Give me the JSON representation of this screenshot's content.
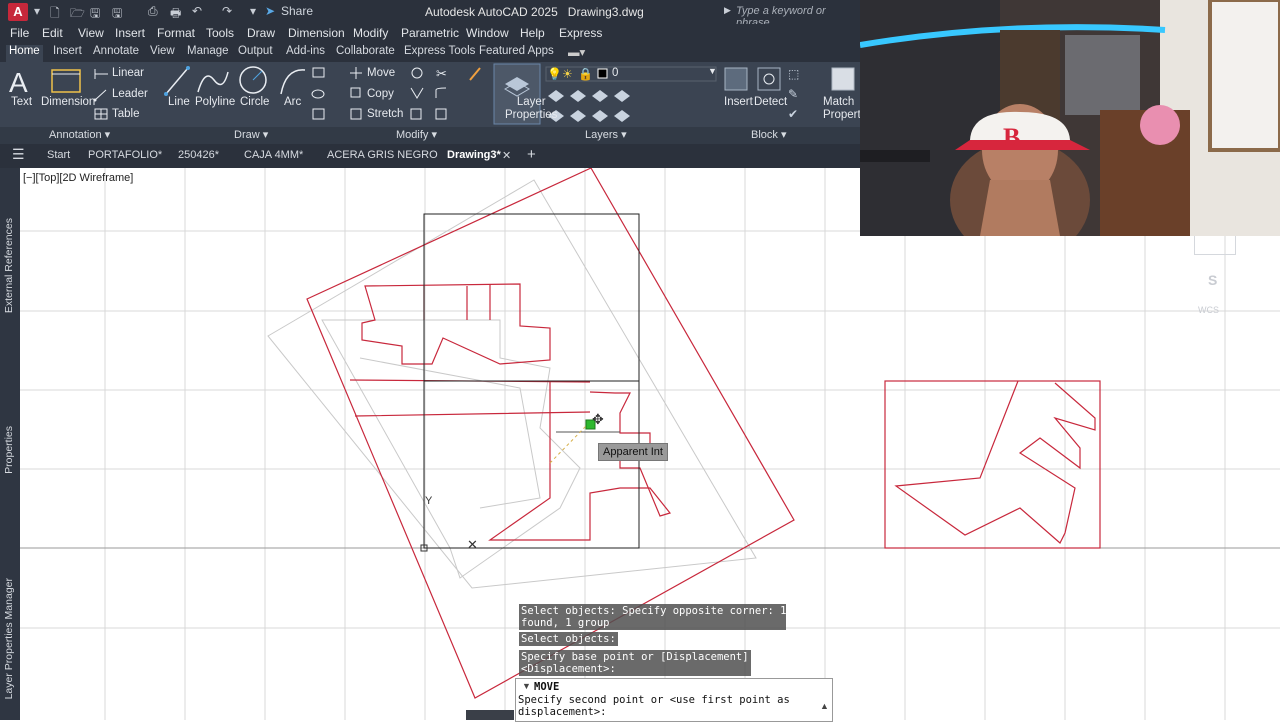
{
  "titlebar": {
    "app_title": "Autodesk AutoCAD 2025",
    "file_name": "Drawing3.dwg",
    "share_label": "Share",
    "search_placeholder": "Type a keyword or phrase"
  },
  "menubar": [
    "File",
    "Edit",
    "View",
    "Insert",
    "Format",
    "Tools",
    "Draw",
    "Dimension",
    "Modify",
    "Parametric",
    "Window",
    "Help",
    "Express"
  ],
  "ribbon_tabs": [
    "Home",
    "Insert",
    "Annotate",
    "View",
    "Manage",
    "Output",
    "Add-ins",
    "Collaborate",
    "Express Tools",
    "Featured Apps"
  ],
  "ribbon": {
    "text": "Text",
    "dimension": "Dimension",
    "linear": "Linear",
    "leader": "Leader",
    "table": "Table",
    "line": "Line",
    "polyline": "Polyline",
    "circle": "Circle",
    "arc": "Arc",
    "move": "Move",
    "copy": "Copy",
    "stretch": "Stretch",
    "layer_properties_1": "Layer",
    "layer_properties_2": "Properties",
    "layer_current": "0",
    "insert": "Insert",
    "detect": "Detect",
    "match_1": "Match",
    "match_2": "Properties"
  },
  "panels": {
    "annotation": "Annotation",
    "draw": "Draw",
    "modify": "Modify",
    "layers": "Layers",
    "block": "Block"
  },
  "file_tabs": [
    "Start",
    "PORTAFOLIO*",
    "250426*",
    "CAJA 4MM*",
    "ACERA GRIS NEGRO",
    "Drawing3*"
  ],
  "left_palettes": [
    "External References",
    "Properties",
    "Layer Properties Manager"
  ],
  "viewport_label": "[−][Top][2D Wireframe]",
  "snap_tooltip": "Apparent Int",
  "command_history": [
    "Select objects: Specify opposite corner: 102\nfound, 1 group",
    "Select objects:",
    "Specify base point or [Displacement]\n<Displacement>:"
  ],
  "command": {
    "name": "MOVE",
    "prompt": "Specify second point or <use first point as\ndisplacement>:"
  },
  "viewcube": {
    "south": "S",
    "wcs": "WCS"
  },
  "colors": {
    "geometry_red": "#c8283c",
    "ribbon_bg": "#3b4452",
    "title_bg": "#2b313c"
  }
}
